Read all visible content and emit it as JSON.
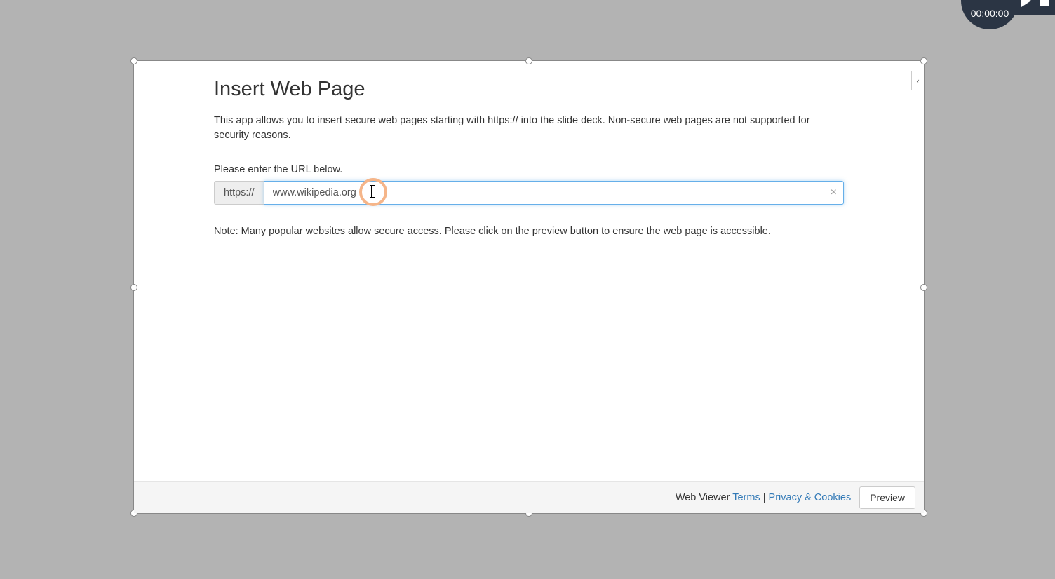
{
  "timer": {
    "elapsed": "00:00:00"
  },
  "dialog": {
    "title": "Insert Web Page",
    "description": "This app allows you to insert secure web pages starting with https:// into the slide deck. Non-secure web pages are not supported for security reasons.",
    "prompt": "Please enter the URL below.",
    "protocol": "https://",
    "url_value": "www.wikipedia.org",
    "note": "Note: Many popular websites allow secure access. Please click on the preview button to ensure the web page is accessible.",
    "collapse_glyph": "‹"
  },
  "footer": {
    "app_name": "Web Viewer ",
    "terms_label": "Terms",
    "separator": " | ",
    "privacy_label": "Privacy & Cookies",
    "preview_label": "Preview"
  }
}
